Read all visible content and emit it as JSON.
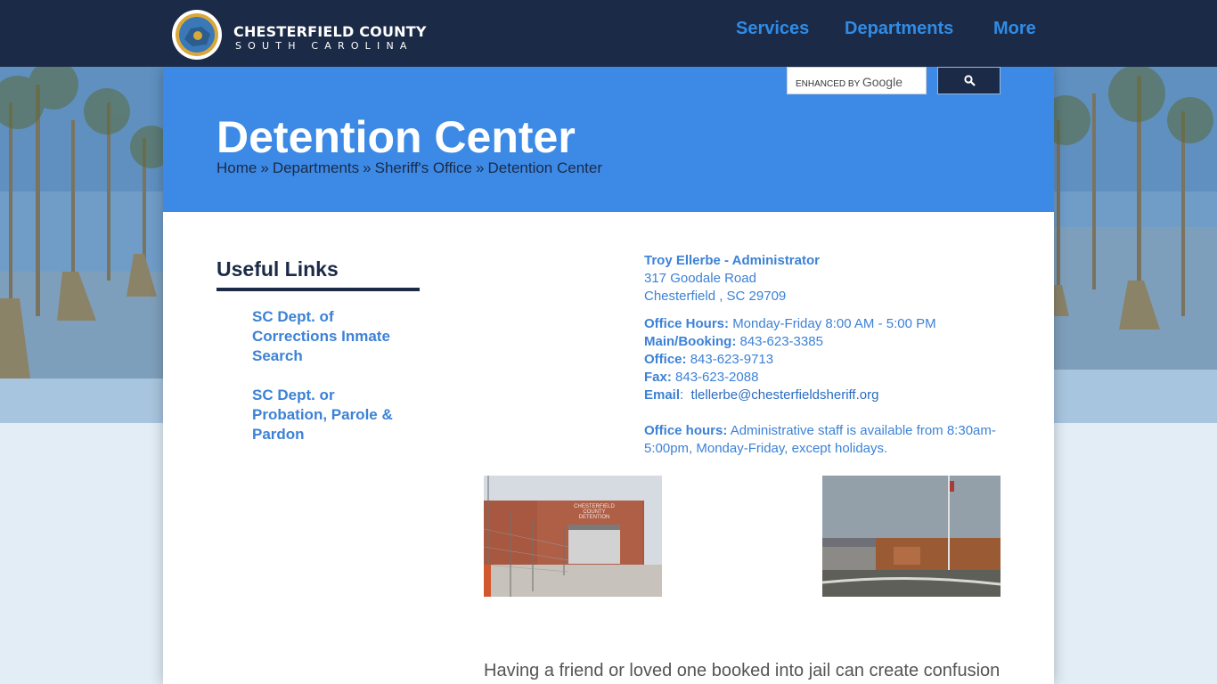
{
  "brand": {
    "county": "CHESTERFIELD COUNTY",
    "state": "SOUTH CAROLINA",
    "seal_icon": "county-seal"
  },
  "nav": {
    "items": [
      {
        "label": "Services"
      },
      {
        "label": "Departments"
      },
      {
        "label": "More"
      }
    ]
  },
  "search": {
    "enhanced_by": "ENHANCED BY",
    "provider": "Google",
    "button_icon": "search-icon"
  },
  "page": {
    "title": "Detention Center",
    "breadcrumb": [
      {
        "label": "Home"
      },
      {
        "label": "Departments"
      },
      {
        "label": "Sheriff's Office"
      },
      {
        "label": "Detention Center"
      }
    ],
    "breadcrumb_sep": "»"
  },
  "sidebar": {
    "heading": "Useful Links",
    "links": [
      {
        "label": "SC Dept. of Corrections Inmate Search"
      },
      {
        "label": "SC Dept. or Probation, Parole & Pardon"
      }
    ]
  },
  "contact": {
    "name": "Troy Ellerbe - Administrator",
    "address_line1": "317 Goodale Road",
    "address_line2": "Chesterfield , SC  29709",
    "office_hours_label": "Office Hours:",
    "office_hours_value": "Monday-Friday 8:00 AM - 5:00 PM",
    "main_booking_label": "Main/Booking:",
    "main_booking_value": "843-623-3385",
    "office_label": "Office:",
    "office_value": "843-623-9713",
    "fax_label": "Fax:",
    "fax_value": "843-623-2088",
    "email_label": "Email",
    "email_value": "tlellerbe@chesterfieldsheriff.org",
    "admin_hours_label": "Office hours:",
    "admin_hours_value": "Administrative staff is available from 8:30am-5:00pm, Monday-Friday, except holidays."
  },
  "photos": {
    "sign_text_1": "CHESTERFIELD",
    "sign_text_2": "COUNTY",
    "sign_text_3": "DETENTION"
  },
  "body": {
    "intro": "Having a friend or loved one booked into jail can create confusion"
  },
  "colors": {
    "navy": "#1b2a46",
    "hero_blue": "#3c8ae6",
    "link_blue": "#3c82d6",
    "nav_blue": "#2f8ce6"
  }
}
